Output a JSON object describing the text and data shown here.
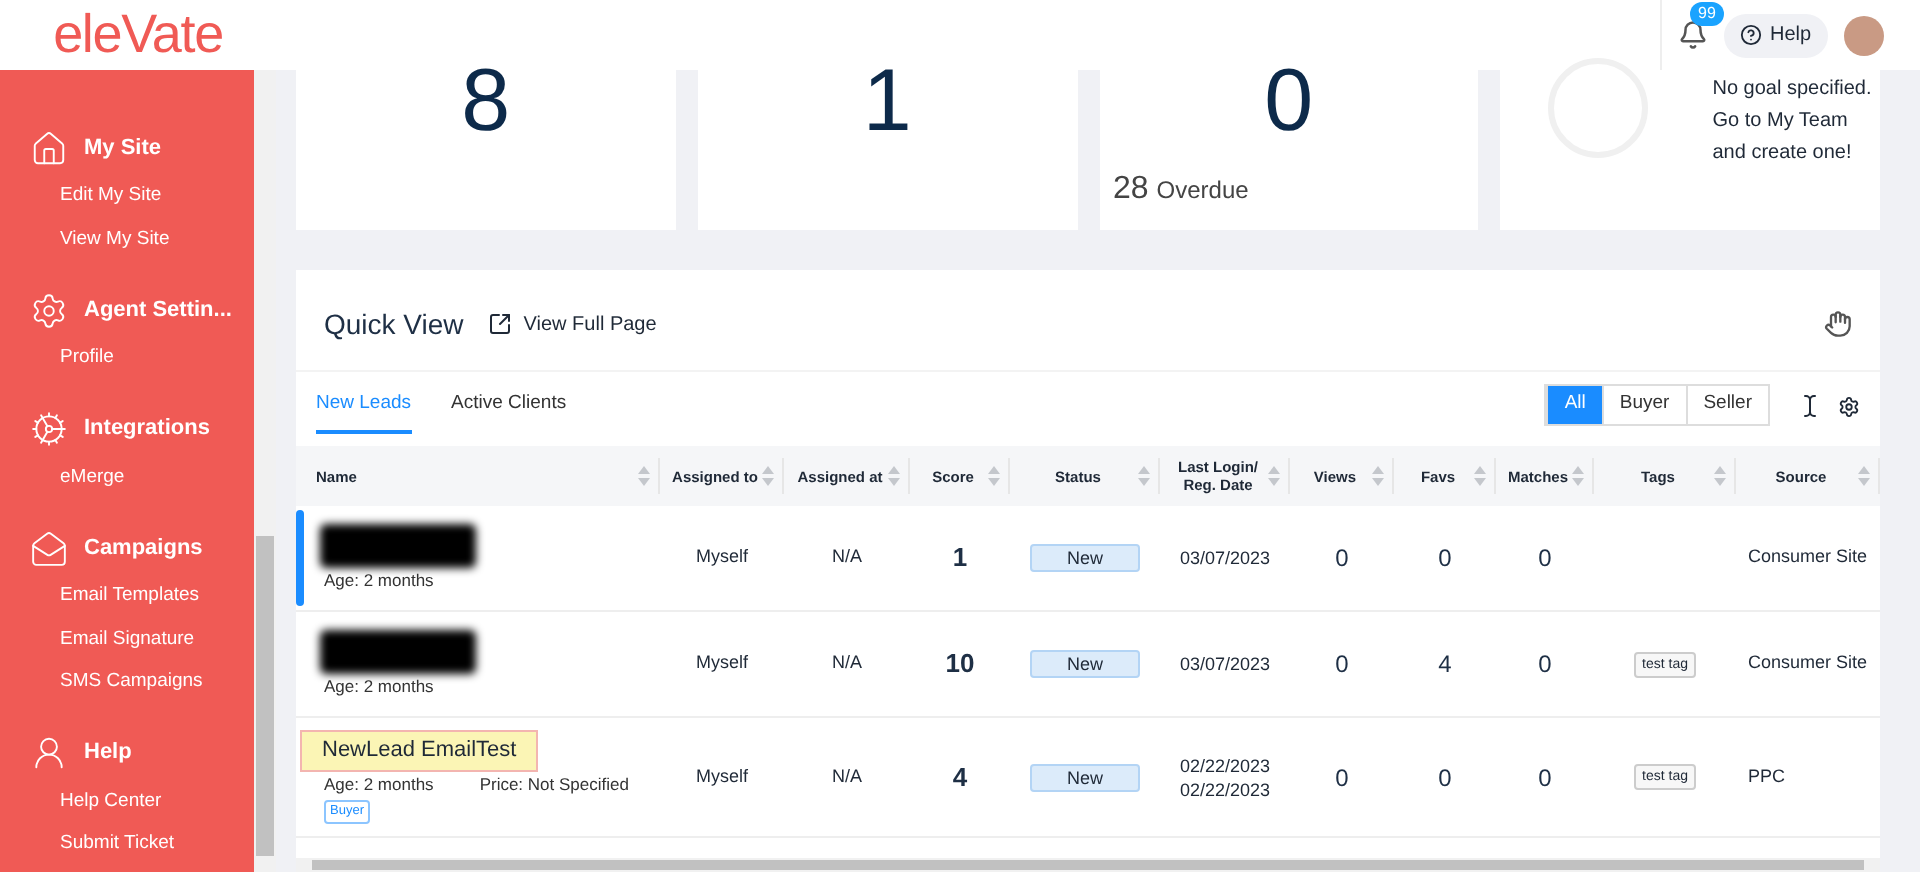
{
  "header": {
    "logo": "eleVate",
    "notifications": "99",
    "help": "Help"
  },
  "sidebar": {
    "sections": [
      {
        "title": "My Site",
        "items": [
          "Edit My Site",
          "View My Site"
        ]
      },
      {
        "title": "Agent Settin...",
        "items": [
          "Profile"
        ]
      },
      {
        "title": "Integrations",
        "items": [
          "eMerge"
        ]
      },
      {
        "title": "Campaigns",
        "items": [
          "Email Templates",
          "Email Signature",
          "SMS Campaigns"
        ]
      },
      {
        "title": "Help",
        "items": [
          "Help Center",
          "Submit Ticket"
        ]
      }
    ]
  },
  "stats": [
    {
      "value": "8"
    },
    {
      "value": "1"
    },
    {
      "value": "0",
      "sub_value": "28",
      "sub_label": "Overdue"
    },
    {
      "goal": "No goal specified. Go to My Team and create one!"
    }
  ],
  "quick_view": {
    "title": "Quick View",
    "link": "View Full Page",
    "tabs": [
      {
        "label": "New Leads",
        "selected": true
      },
      {
        "label": "Active Clients",
        "selected": false
      }
    ],
    "filters": [
      {
        "label": "All",
        "selected": true
      },
      {
        "label": "Buyer",
        "selected": false
      },
      {
        "label": "Seller",
        "selected": false
      }
    ],
    "columns": [
      "Name",
      "Assigned to",
      "Assigned at",
      "Score",
      "Status",
      "Last Login/ Reg. Date",
      "Views",
      "Favs",
      "Matches",
      "Tags",
      "Source"
    ],
    "rows": [
      {
        "selected": true,
        "age": "Age: 2 months",
        "assigned_to": "Myself",
        "assigned_at": "N/A",
        "score": "1",
        "status": "New",
        "dates": [
          "03/07/2023"
        ],
        "views": "0",
        "favs": "0",
        "matches": "0",
        "source": "Consumer Site"
      },
      {
        "selected": false,
        "age": "Age: 2 months",
        "assigned_to": "Myself",
        "assigned_at": "N/A",
        "score": "10",
        "status": "New",
        "dates": [
          "03/07/2023"
        ],
        "views": "0",
        "favs": "4",
        "matches": "0",
        "tag": "test tag",
        "source": "Consumer Site"
      },
      {
        "selected": false,
        "name": "NewLead EmailTest",
        "highlighted": true,
        "age": "Age: 2 months",
        "price": "Price: Not Specified",
        "type": "Buyer",
        "assigned_to": "Myself",
        "assigned_at": "N/A",
        "score": "4",
        "status": "New",
        "dates": [
          "02/22/2023",
          "02/22/2023"
        ],
        "views": "0",
        "favs": "0",
        "matches": "0",
        "tag": "test tag",
        "source": "PPC"
      }
    ]
  }
}
